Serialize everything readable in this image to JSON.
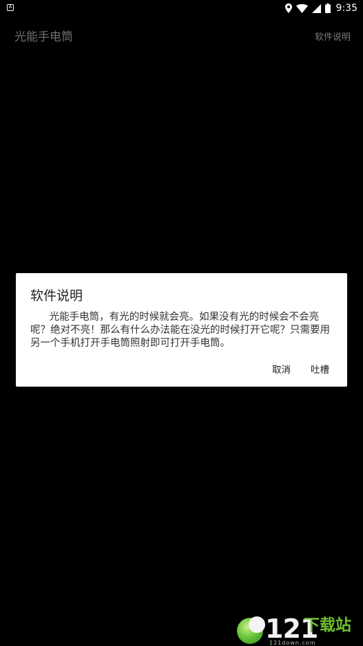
{
  "status_bar": {
    "time": "9:35",
    "notification_icon": "a-box-icon"
  },
  "app_bar": {
    "title": "光能手电筒",
    "action_label": "软件说明"
  },
  "dialog": {
    "title": "软件说明",
    "message": "      光能手电筒，有光的时候就会亮。如果没有光的时候会不会亮呢？绝对不亮！那么有什么办法能在没光的时候打开它呢？只需要用另一个手机打开手电筒照射即可打开手电筒。",
    "cancel_label": "取消",
    "complain_label": "吐槽"
  },
  "watermark": {
    "number": "121",
    "brand": "下载站",
    "url": "121down.com",
    "colors": {
      "green": "#6fbf2f"
    }
  }
}
